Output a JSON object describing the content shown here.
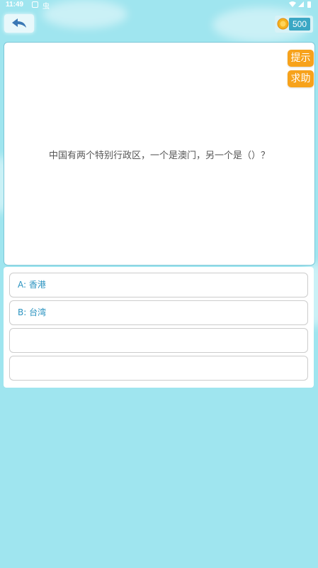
{
  "status_bar": {
    "time": "11:49",
    "notification": "虫"
  },
  "header": {
    "coins": "500"
  },
  "question": {
    "text": "中国有两个特别行政区，一个是澳门，另一个是（）？",
    "hint_label": "提示",
    "help_label": "求助"
  },
  "options": [
    {
      "label": "A: 香港"
    },
    {
      "label": "B: 台湾"
    },
    {
      "label": ""
    },
    {
      "label": ""
    }
  ],
  "colors": {
    "background": "#9fe5ef",
    "accent_orange": "#f7a21b",
    "option_text": "#2a93c0",
    "coin_badge": "#3aa7c4"
  },
  "icons": {
    "back": "back-arrow-icon",
    "coin": "coin-icon",
    "wifi": "wifi-icon",
    "signal": "signal-icon",
    "battery": "battery-icon"
  }
}
